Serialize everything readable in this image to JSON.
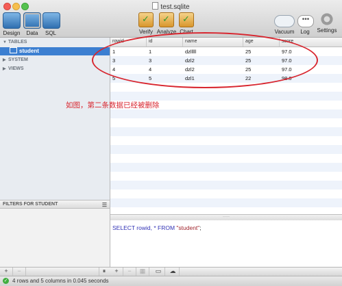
{
  "window": {
    "title": "test.sqlite"
  },
  "toolbar": {
    "design_label": "Design",
    "data_label": "Data",
    "sql_label": "SQL",
    "verify_label": "Verify",
    "analyze_label": "Analyze",
    "chart_label": "Chart",
    "vacuum_label": "Vacuum",
    "log_label": "Log",
    "settings_label": "Settings"
  },
  "sidebar": {
    "tables_header": "TABLES",
    "selected_table": "student",
    "system_header": "SYSTEM",
    "views_header": "VIEWS",
    "filters_header": "FILTERS FOR STUDENT"
  },
  "grid": {
    "columns": [
      "rowid",
      "id",
      "name",
      "age",
      "score"
    ],
    "rows": [
      [
        "1",
        "1",
        "dzlllll",
        "25",
        "97.0"
      ],
      [
        "3",
        "3",
        "dzl2",
        "25",
        "97.0"
      ],
      [
        "4",
        "4",
        "dzl2",
        "25",
        "97.0"
      ],
      [
        "5",
        "5",
        "dzl1",
        "22",
        "98.0"
      ]
    ]
  },
  "annotation": {
    "text": "如图，第二条数据已经被删除",
    "color": "#d8262f"
  },
  "sql": {
    "select_kw": "SELECT",
    "cols": " rowid, * ",
    "from_kw": "FROM",
    "table": " \"student\"",
    "end": ";"
  },
  "bottom_bar": {
    "add": "+",
    "remove": "−",
    "pause": "⏸"
  },
  "status": {
    "text": "4 rows and 5 columns in 0.045 seconds"
  },
  "colors": {
    "accent": "#3c7fd1",
    "keyword": "#3031b5",
    "string": "#a0242c"
  }
}
